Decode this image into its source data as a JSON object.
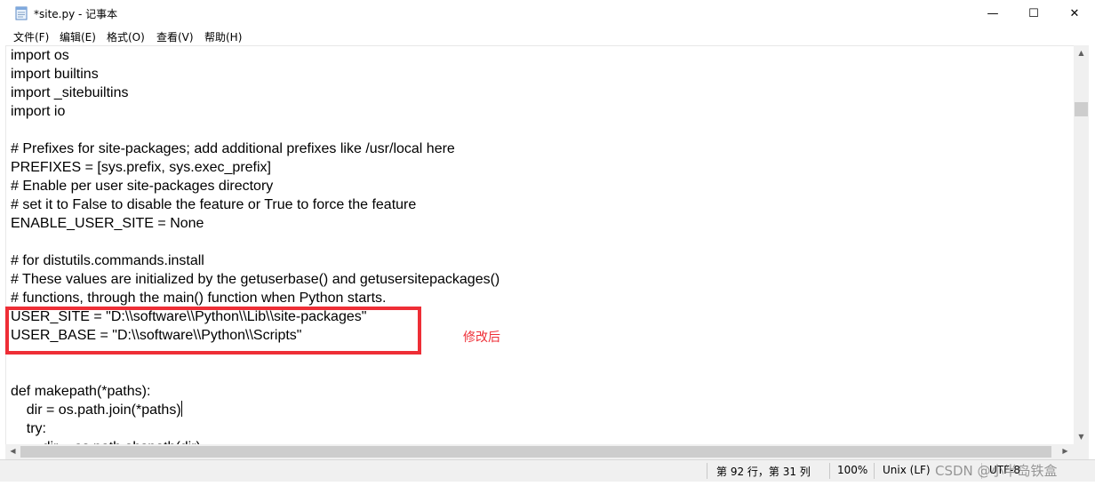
{
  "window": {
    "title": "*site.py - 记事本",
    "controls": {
      "minimize": "—",
      "maximize": "☐",
      "close": "✕"
    }
  },
  "menubar": {
    "items": [
      {
        "label": "文件(F)"
      },
      {
        "label": "编辑(E)"
      },
      {
        "label": "格式(O)"
      },
      {
        "label": "查看(V)"
      },
      {
        "label": "帮助(H)"
      }
    ]
  },
  "editor": {
    "lines": [
      "import os",
      "import builtins",
      "import _sitebuiltins",
      "import io",
      "",
      "# Prefixes for site-packages; add additional prefixes like /usr/local here",
      "PREFIXES = [sys.prefix, sys.exec_prefix]",
      "# Enable per user site-packages directory",
      "# set it to False to disable the feature or True to force the feature",
      "ENABLE_USER_SITE = None",
      "",
      "# for distutils.commands.install",
      "# These values are initialized by the getuserbase() and getusersitepackages()",
      "# functions, through the main() function when Python starts.",
      "USER_SITE = \"D:\\\\software\\\\Python\\\\Lib\\\\site-packages\"",
      "USER_BASE = \"D:\\\\software\\\\Python\\\\Scripts\"",
      "",
      "",
      "def makepath(*paths):",
      "    dir = os.path.join(*paths)",
      "    try:",
      "        dir = os.path.abspath(dir)"
    ]
  },
  "annotation": {
    "label": "修改后",
    "color": "#ee2e36"
  },
  "statusbar": {
    "position": "第 92 行，第 31 列",
    "zoom": "100%",
    "line_ending": "Unix (LF)",
    "encoding": "UTF-8"
  },
  "watermark": "CSDN @小半岛铁盒",
  "icons": {
    "app": "notepad-icon",
    "scroll_up": "chevron-up-icon",
    "scroll_down": "chevron-down-icon",
    "scroll_left": "chevron-left-icon",
    "scroll_right": "chevron-right-icon"
  }
}
